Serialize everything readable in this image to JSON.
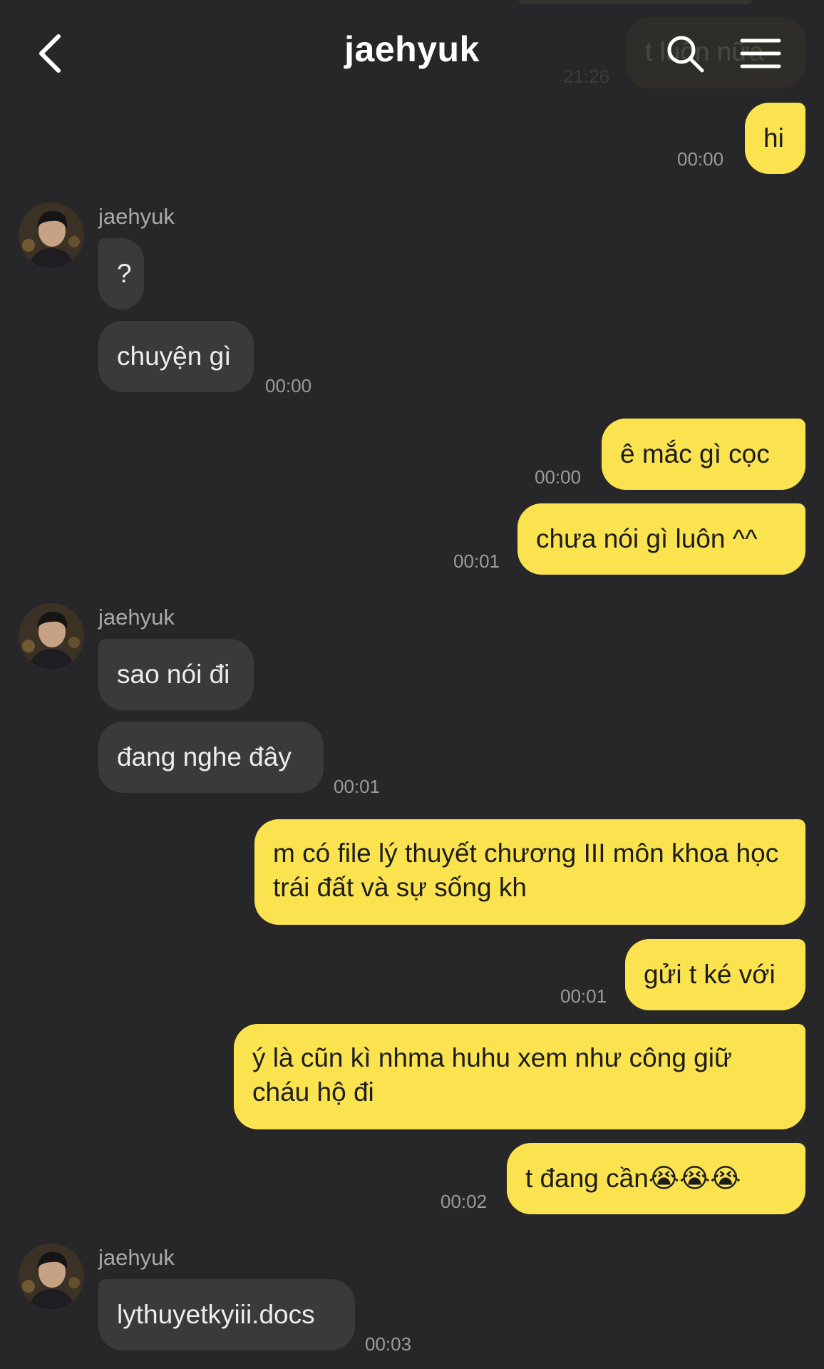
{
  "header": {
    "title": "jaehyuk"
  },
  "previous_message": {
    "text": "t luôn nữa",
    "time": "21:26"
  },
  "messages": [
    {
      "text": "hi",
      "time": "00:00"
    },
    {
      "sender": "jaehyuk",
      "text": "?"
    },
    {
      "text": "chuyện gì",
      "time": "00:00"
    },
    {
      "text": "ê mắc gì cọc",
      "time": "00:00"
    },
    {
      "text": "chưa nói gì luôn ^^",
      "time": "00:01"
    },
    {
      "sender": "jaehyuk",
      "text": "sao nói đi"
    },
    {
      "text": "đang nghe đây",
      "time": "00:01"
    },
    {
      "text": "m có file lý thuyết chương III môn khoa học trái đất và sự sống kh"
    },
    {
      "text": "gửi t ké với",
      "time": "00:01"
    },
    {
      "text": "ý là cũn kì nhma huhu xem như công giữ cháu hộ đi"
    },
    {
      "text": "t đang cần😭😭😭",
      "time": "00:02"
    },
    {
      "sender": "jaehyuk",
      "text": "lythuyetkyiii.docs",
      "time": "00:03"
    }
  ],
  "icons": {
    "back": "chevron-left-icon",
    "search": "search-icon",
    "menu": "hamburger-menu-icon",
    "avatar": "profile-avatar"
  },
  "colors": {
    "background": "#27272a",
    "sent_bubble": "#fae34f",
    "received_bubble": "#3a3a3d",
    "timestamp": "#9b9b9b"
  }
}
